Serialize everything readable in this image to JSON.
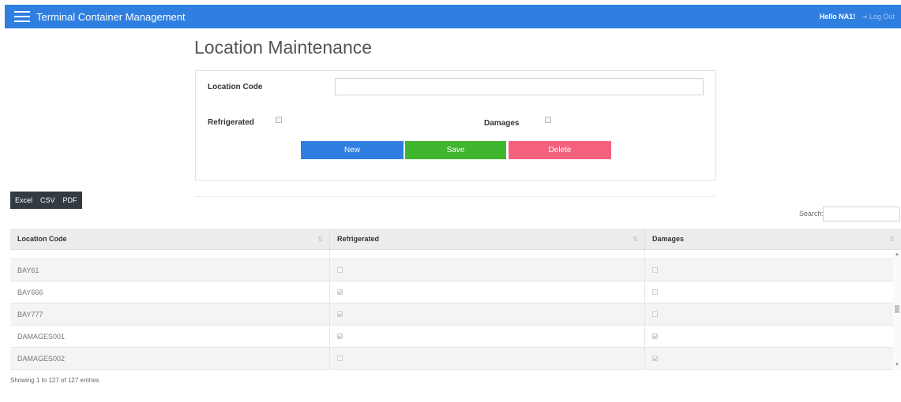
{
  "header": {
    "title": "Terminal Container Management",
    "greeting": "Hello NA1!",
    "logout_label": "Log Out"
  },
  "page": {
    "title": "Location Maintenance"
  },
  "form": {
    "location_code_label": "Location Code",
    "location_code_value": "",
    "refrigerated_label": "Refrigerated",
    "refrigerated_checked": false,
    "damages_label": "Damages",
    "damages_checked": false,
    "buttons": {
      "new": "New",
      "save": "Save",
      "delete": "Delete"
    }
  },
  "export": {
    "buttons": [
      "Excel",
      "CSV",
      "PDF"
    ]
  },
  "search": {
    "label": "Search:",
    "value": ""
  },
  "table": {
    "columns": [
      "Location Code",
      "Refrigerated",
      "Damages"
    ],
    "rows": [
      {
        "code": "BAY61",
        "refrigerated": false,
        "damages": false
      },
      {
        "code": "BAY666",
        "refrigerated": true,
        "damages": false
      },
      {
        "code": "BAY777",
        "refrigerated": true,
        "damages": false
      },
      {
        "code": "DAMAGES001",
        "refrigerated": true,
        "damages": true
      },
      {
        "code": "DAMAGES002",
        "refrigerated": false,
        "damages": true
      }
    ]
  },
  "footer": {
    "info": "Showing 1 to 127 of 127 entries"
  },
  "colors": {
    "primary": "#2f7fe0",
    "success": "#3fb62d",
    "danger": "#f3617d",
    "dark": "#333a40"
  }
}
